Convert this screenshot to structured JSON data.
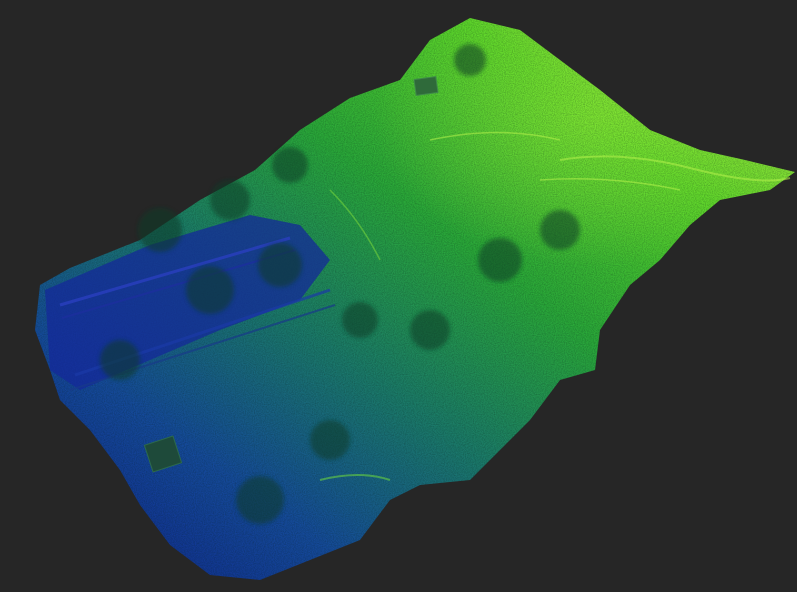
{
  "viewport": {
    "background": "#262626"
  },
  "point_cloud": {
    "subject": "terrain-lidar-point-cloud",
    "colormap": {
      "low": "#1428a0",
      "mid_low": "#1a6a8a",
      "mid": "#2a9a4a",
      "mid_high": "#4cc82a",
      "high": "#b4f040"
    }
  }
}
